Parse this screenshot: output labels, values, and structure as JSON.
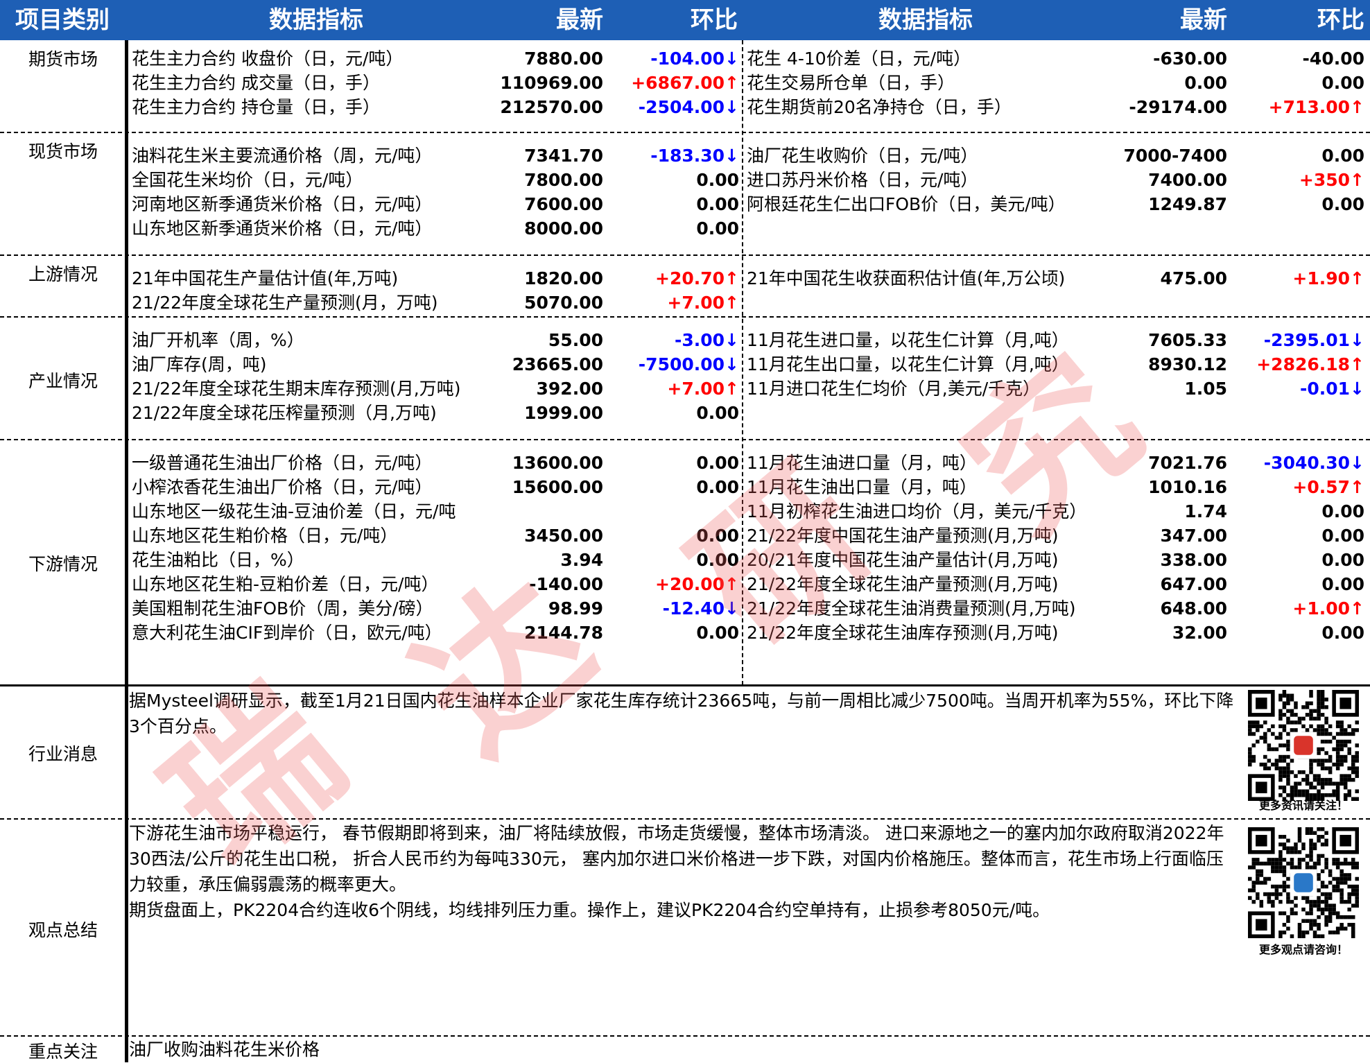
{
  "header": {
    "category": "项目类别",
    "indicator_left": "数据指标",
    "latest_left": "最新",
    "change_left": "环比",
    "indicator_right": "数据指标",
    "latest_right": "最新",
    "change_right": "环比"
  },
  "sections": [
    {
      "name": "期货市场",
      "rows": [
        {
          "l": "花生主力合约 收盘价（日，元/吨）",
          "lv": "7880.00",
          "lc": "-104.00↓",
          "ld": "down",
          "r": "花生 4-10价差（日，元/吨）",
          "rv": "-630.00",
          "rc": "-40.00",
          "rd": ""
        },
        {
          "l": "花生主力合约 成交量（日，手）",
          "lv": "110969.00",
          "lc": "+6867.00↑",
          "ld": "up",
          "r": "花生交易所仓单（日，手）",
          "rv": "0.00",
          "rc": "0.00",
          "rd": ""
        },
        {
          "l": "花生主力合约 持仓量（日，手）",
          "lv": "212570.00",
          "lc": "-2504.00↓",
          "ld": "down",
          "r": "花生期货前20名净持仓（日，手）",
          "rv": "-29174.00",
          "rc": "+713.00↑",
          "rd": "up"
        }
      ]
    },
    {
      "name": "现货市场",
      "rows": [
        {
          "l": "油料花生米主要流通价格（周，元/吨）",
          "lv": "7341.70",
          "lc": "-183.30↓",
          "ld": "down",
          "r": "油厂花生收购价（日，元/吨）",
          "rv": "7000-7400",
          "rc": "0.00",
          "rd": ""
        },
        {
          "l": "全国花生米均价（日，元/吨）",
          "lv": "7800.00",
          "lc": "0.00",
          "ld": "",
          "r": "进口苏丹米价格（日，元/吨）",
          "rv": "7400.00",
          "rc": "+350↑",
          "rd": "up"
        },
        {
          "l": "河南地区新季通货米价格（日，元/吨）",
          "lv": "7600.00",
          "lc": "0.00",
          "ld": "",
          "r": "阿根廷花生仁出口FOB价（日，美元/吨）",
          "rv": "1249.87",
          "rc": "0.00",
          "rd": ""
        },
        {
          "l": "山东地区新季通货米价格（日，元/吨）",
          "lv": "8000.00",
          "lc": "0.00",
          "ld": "",
          "r": "",
          "rv": "",
          "rc": "",
          "rd": ""
        }
      ]
    },
    {
      "name": "上游情况",
      "rows": [
        {
          "l": "21年中国花生产量估计值(年,万吨)",
          "lv": "1820.00",
          "lc": "+20.70↑",
          "ld": "up",
          "r": "21年中国花生收获面积估计值(年,万公顷)",
          "rv": "475.00",
          "rc": "+1.90↑",
          "rd": "up"
        },
        {
          "l": "21/22年度全球花生产量预测(月，万吨)",
          "lv": "5070.00",
          "lc": "+7.00↑",
          "ld": "up",
          "r": "",
          "rv": "",
          "rc": "",
          "rd": ""
        }
      ]
    },
    {
      "name": "产业情况",
      "rows": [
        {
          "l": "油厂开机率（周，%）",
          "lv": "55.00",
          "lc": "-3.00↓",
          "ld": "down",
          "r": "11月花生进口量，以花生仁计算（月,吨）",
          "rv": "7605.33",
          "rc": "-2395.01↓",
          "rd": "down"
        },
        {
          "l": "油厂库存(周，吨)",
          "lv": "23665.00",
          "lc": "-7500.00↓",
          "ld": "down",
          "r": "11月花生出口量，以花生仁计算（月,吨）",
          "rv": "8930.12",
          "rc": "+2826.18↑",
          "rd": "up"
        },
        {
          "l": "21/22年度全球花生期末库存预测(月,万吨)",
          "lv": "392.00",
          "lc": "+7.00↑",
          "ld": "up",
          "r": "11月进口花生仁均价（月,美元/千克）",
          "rv": "1.05",
          "rc": "-0.01↓",
          "rd": "down"
        },
        {
          "l": "21/22年度全球花压榨量预测（月,万吨)",
          "lv": "1999.00",
          "lc": "0.00",
          "ld": "",
          "r": "",
          "rv": "",
          "rc": "",
          "rd": ""
        }
      ]
    },
    {
      "name": "下游情况",
      "rows": [
        {
          "l": "一级普通花生油出厂价格（日，元/吨）",
          "lv": "13600.00",
          "lc": "0.00",
          "ld": "",
          "r": "11月花生油进口量（月，吨）",
          "rv": "7021.76",
          "rc": "-3040.30↓",
          "rd": "down"
        },
        {
          "l": "小榨浓香花生油出厂价格（日，元/吨）",
          "lv": "15600.00",
          "lc": "0.00",
          "ld": "",
          "r": "11月花生油出口量（月，吨）",
          "rv": "1010.16",
          "rc": "+0.57↑",
          "rd": "up"
        },
        {
          "l": "山东地区一级花生油-豆油价差（日，元/吨",
          "lv": "",
          "lc": "",
          "ld": "",
          "r": "11月初榨花生油进口均价（月，美元/千克）",
          "rv": "1.74",
          "rc": "0.00",
          "rd": ""
        },
        {
          "l": "山东地区花生粕价格（日，元/吨）",
          "lv": "3450.00",
          "lc": "0.00",
          "ld": "",
          "r": "21/22年度中国花生油产量预测(月,万吨)",
          "rv": "347.00",
          "rc": "0.00",
          "rd": ""
        },
        {
          "l": "花生油粕比（日，%）",
          "lv": "3.94",
          "lc": "0.00",
          "ld": "",
          "r": "20/21年度中国花生油产量估计(月,万吨)",
          "rv": "338.00",
          "rc": "0.00",
          "rd": ""
        },
        {
          "l": "山东地区花生粕-豆粕价差（日，元/吨）",
          "lv": "-140.00",
          "lc": "+20.00↑",
          "ld": "up",
          "r": "21/22年度全球花生油产量预测(月,万吨)",
          "rv": "647.00",
          "rc": "0.00",
          "rd": ""
        },
        {
          "l": "美国粗制花生油FOB价（周，美分/磅）",
          "lv": "98.99",
          "lc": "-12.40↓",
          "ld": "down",
          "r": "21/22年度全球花生油消费量预测(月,万吨)",
          "rv": "648.00",
          "rc": "+1.00↑",
          "rd": "up"
        },
        {
          "l": "意大利花生油CIF到岸价（日，欧元/吨）",
          "lv": "2144.78",
          "lc": "0.00",
          "ld": "",
          "r": "21/22年度全球花生油库存预测(月,万吨)",
          "rv": "32.00",
          "rc": "0.00",
          "rd": ""
        }
      ]
    }
  ],
  "news": {
    "label": "行业消息",
    "text": "据Mysteel调研显示，截至1月21日国内花生油样本企业厂家花生库存统计23665吨，与前一周相比减少7500吨。当周开机率为55%，环比下降3个百分点。",
    "qr_caption": "更多资讯请关注！"
  },
  "summary": {
    "label": "观点总结",
    "text1": " 下游花生油市场平稳运行， 春节假期即将到来，油厂将陆续放假，市场走货缓慢，整体市场清淡。 进口来源地之一的塞内加尔政府取消2022年30西法/公斤的花生出口税， 折合人民币约为每吨330元， 塞内加尔进口米价格进一步下跌，对国内价格施压。整体而言，花生市场上行面临压力较重，承压偏弱震荡的概率更大。",
    "text2": "期货盘面上，PK2204合约连收6个阴线，均线排列压力重。操作上，建议PK2204合约空单持有，止损参考8050元/吨。",
    "qr_caption": "更多观点请咨询！"
  },
  "focus": {
    "label": "重点关注",
    "text": "油厂收购油料花生米价格"
  },
  "watermark": "瑞达研究",
  "colors": {
    "header_bg": "#1e5fb5",
    "up": "#ff0000",
    "down": "#0000ff",
    "watermark": "#ee5a5a"
  }
}
